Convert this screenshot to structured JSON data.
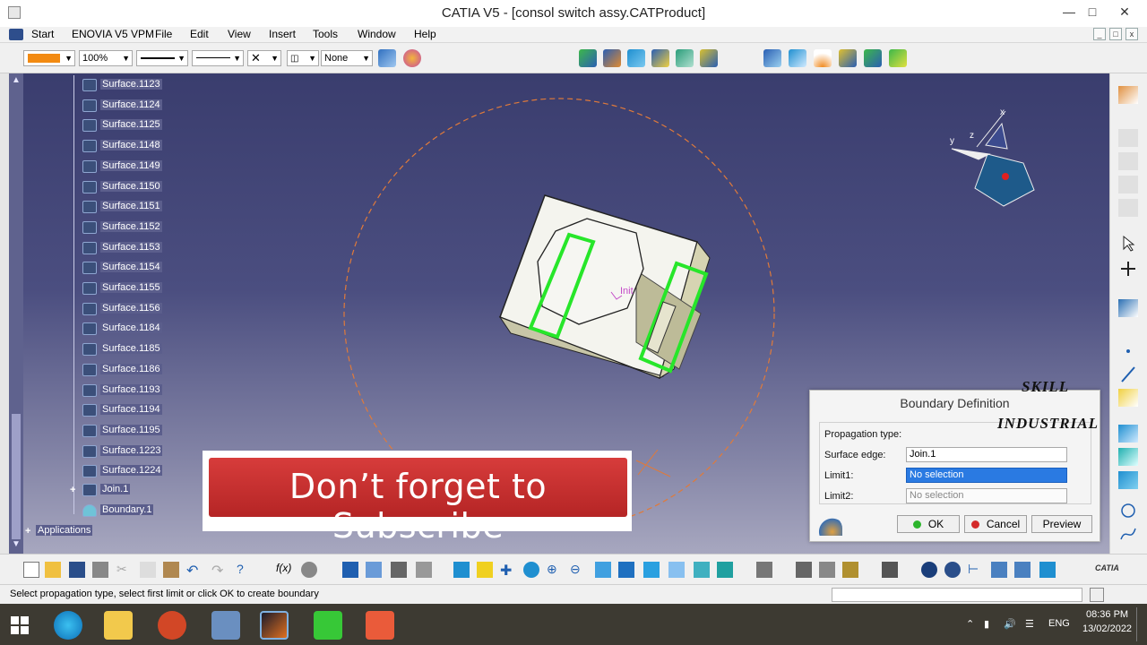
{
  "window": {
    "title": "CATIA V5 - [consol switch assy.CATProduct]"
  },
  "menu": {
    "items": [
      {
        "label": "Start"
      },
      {
        "label": "ENOVIA V5 VPM"
      },
      {
        "label": "File"
      },
      {
        "label": "Edit"
      },
      {
        "label": "View"
      },
      {
        "label": "Insert"
      },
      {
        "label": "Tools"
      },
      {
        "label": "Window"
      },
      {
        "label": "Help"
      }
    ]
  },
  "toolbar": {
    "zoom_value": "100%",
    "layer_value": "None",
    "color_swatch": "#f28a12"
  },
  "tree": {
    "items": [
      {
        "label": "Surface.1123"
      },
      {
        "label": "Surface.1124"
      },
      {
        "label": "Surface.1125"
      },
      {
        "label": "Surface.1148"
      },
      {
        "label": "Surface.1149"
      },
      {
        "label": "Surface.1150"
      },
      {
        "label": "Surface.1151"
      },
      {
        "label": "Surface.1152"
      },
      {
        "label": "Surface.1153"
      },
      {
        "label": "Surface.1154"
      },
      {
        "label": "Surface.1155"
      },
      {
        "label": "Surface.1156"
      },
      {
        "label": "Surface.1184"
      },
      {
        "label": "Surface.1185"
      },
      {
        "label": "Surface.1186"
      },
      {
        "label": "Surface.1193"
      },
      {
        "label": "Surface.1194"
      },
      {
        "label": "Surface.1195"
      },
      {
        "label": "Surface.1223"
      },
      {
        "label": "Surface.1224"
      }
    ],
    "join": "Join.1",
    "boundary": "Boundary.1",
    "applications": "Applications"
  },
  "viewport": {
    "init_label": "Init",
    "compass": {
      "x": "x",
      "y": "y",
      "z": "z"
    }
  },
  "dialog": {
    "title": "Boundary Definition",
    "propagation_label": "Propagation type:",
    "surface_edge_label": "Surface edge:",
    "surface_edge_value": "Join.1",
    "limit1_label": "Limit1:",
    "limit1_value": "No selection",
    "limit2_label": "Limit2:",
    "limit2_value": "No selection",
    "ok_label": "OK",
    "cancel_label": "Cancel",
    "preview_label": "Preview"
  },
  "overlay": {
    "subscribe_text": "Don’t forget to Subscribe",
    "watermark_line1": "SKILL",
    "watermark_line2": "INDUSTRIAL"
  },
  "status": {
    "message": "Select propagation type, select first limit or click OK to create boundary"
  },
  "taskbar": {
    "language": "ENG",
    "time": "08:36 PM",
    "date": "13/02/2022"
  },
  "brand": {
    "catia_logo": "CATIA"
  }
}
